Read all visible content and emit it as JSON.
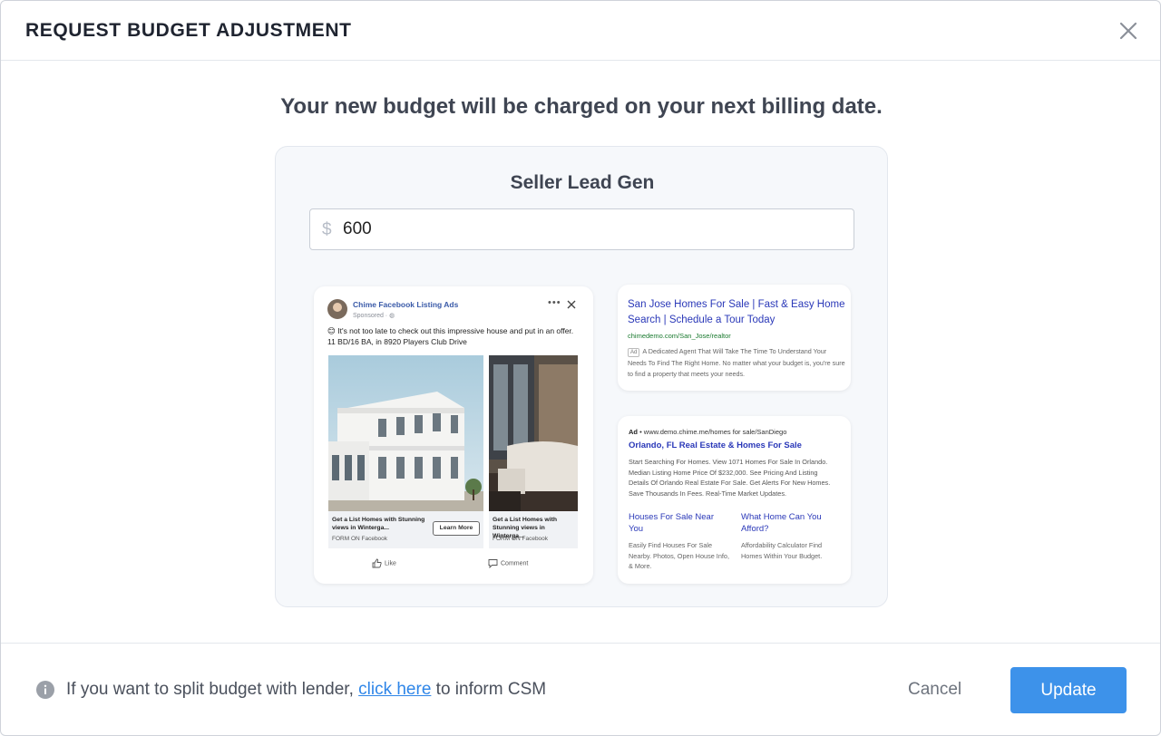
{
  "modal": {
    "title": "REQUEST BUDGET ADJUSTMENT",
    "headline": "Your new budget will be charged on your next billing date."
  },
  "card": {
    "title": "Seller Lead Gen",
    "currency_symbol": "$",
    "amount_value": "600"
  },
  "facebook_ad": {
    "page_name": "Chime Facebook Listing Ads",
    "sponsored": "Sponsored ·",
    "text_line1": "😊 It's not too late to check out this impressive house and put in an offer.",
    "text_line2": "11 BD/16 BA, in 8920 Players Club Drive",
    "carousel": [
      {
        "title": "Get a List Homes with Stunning views in Winterga...",
        "source": "FORM ON Facebook",
        "cta": "Learn More"
      },
      {
        "title": "Get a List Homes with Stunning views in Winterga...",
        "source": "FORM ON Facebook"
      }
    ],
    "like_label": "Like",
    "comment_label": "Comment"
  },
  "google_ad_1": {
    "title": "San Jose Homes For Sale | Fast & Easy Home Search | Schedule a Tour Today",
    "url": "chimedemo.com/San_Jose/realtor",
    "badge": "Ad",
    "description": "A Dedicated Agent That Will Take The Time To Understand Your Needs To Find The Right Home. No matter what your budget is, you're sure to find a property that meets your needs."
  },
  "google_ad_2": {
    "ad_label": "Ad",
    "url": " • www.demo.chime.me/homes for sale/SanDiego",
    "title": "Orlando, FL Real Estate & Homes For Sale",
    "description": "Start Searching For Homes. View 1071 Homes For Sale In Orlando. Median Listing Home Price Of $232,000. See Pricing And Listing Details Of Orlando Real Estate For Sale. Get Alerts For New Homes. Save Thousands In Fees. Real-Time Market Updates.",
    "sitelinks": [
      {
        "title": "Houses For Sale Near You",
        "description": "Easily Find Houses For Sale Nearby. Photos, Open House Info, & More."
      },
      {
        "title": "What Home Can You Afford?",
        "description": "Affordability Calculator Find Homes Within Your Budget."
      }
    ]
  },
  "footer": {
    "note_prefix": "If you want to split budget with lender, ",
    "note_link": "click here",
    "note_suffix": " to inform CSM",
    "cancel_label": "Cancel",
    "update_label": "Update"
  },
  "colors": {
    "accent": "#3d92ea",
    "link": "#2f86e8",
    "ad_title": "#2a38b8",
    "ad_url": "#1a7a2f"
  }
}
